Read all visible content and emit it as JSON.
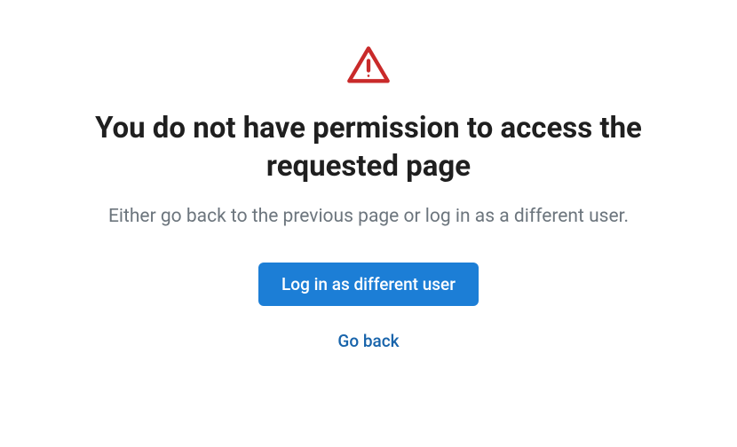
{
  "error": {
    "heading": "You do not have permission to access the requested page",
    "description": "Either go back to the previous page or log in as a different user.",
    "primary_action_label": "Log in as different user",
    "secondary_action_label": "Go back"
  }
}
